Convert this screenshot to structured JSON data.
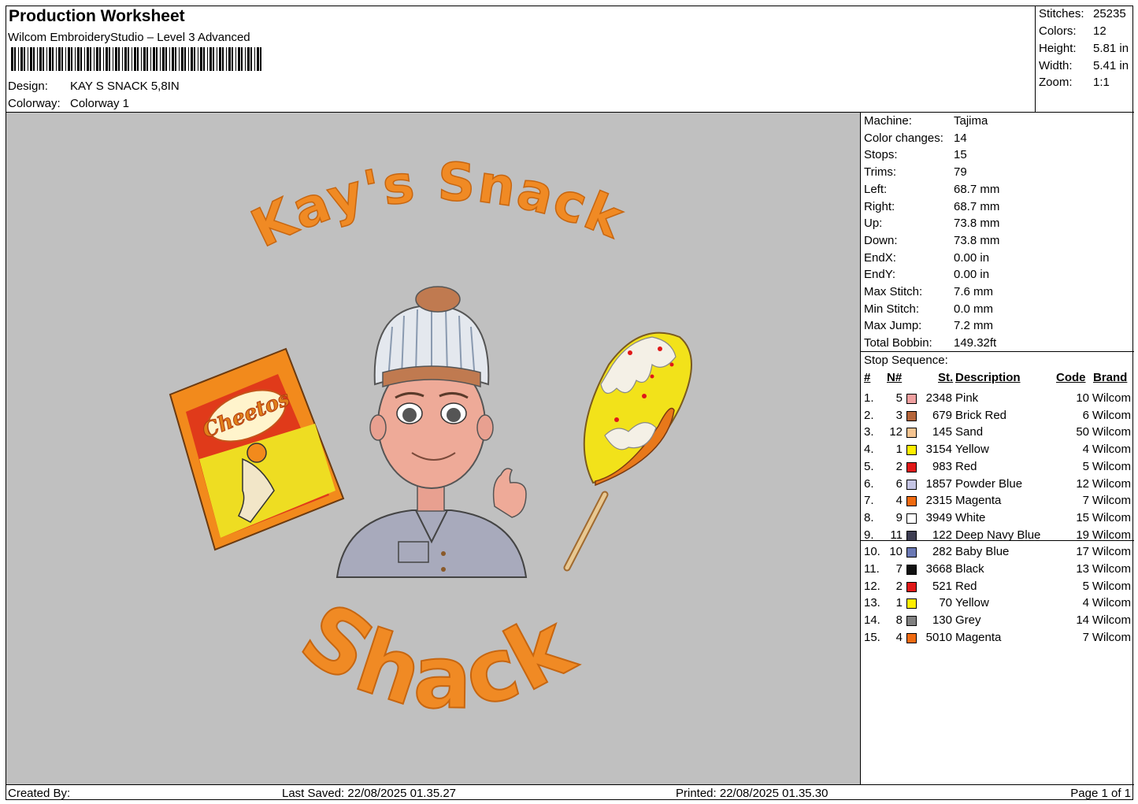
{
  "header": {
    "title": "Production Worksheet",
    "software": "Wilcom EmbroideryStudio – Level 3 Advanced",
    "design_label": "Design:",
    "design_value": "KAY S SNACK 5,8IN",
    "colorway_label": "Colorway:",
    "colorway_value": "Colorway 1"
  },
  "summary": {
    "stitches_label": "Stitches:",
    "stitches_value": "25235",
    "colors_label": "Colors:",
    "colors_value": "12",
    "height_label": "Height:",
    "height_value": "5.81 in",
    "width_label": "Width:",
    "width_value": "5.41 in",
    "zoom_label": "Zoom:",
    "zoom_value": "1:1"
  },
  "design_art": {
    "top_text": "Kay's Snack",
    "bottom_text": "Shack",
    "bag_text": "Cheetos",
    "thread_orange": "#f08a24",
    "background": "#c0c0c0"
  },
  "machine": {
    "rows": [
      {
        "label": "Machine:",
        "value": "Tajima"
      },
      {
        "label": "Color changes:",
        "value": "14"
      },
      {
        "label": "Stops:",
        "value": "15"
      },
      {
        "label": "Trims:",
        "value": "79"
      },
      {
        "label": "Left:",
        "value": "68.7 mm"
      },
      {
        "label": "Right:",
        "value": "68.7 mm"
      },
      {
        "label": "Up:",
        "value": "73.8 mm"
      },
      {
        "label": "Down:",
        "value": "73.8 mm"
      },
      {
        "label": "EndX:",
        "value": "0.00 in"
      },
      {
        "label": "EndY:",
        "value": "0.00 in"
      },
      {
        "label": "Max Stitch:",
        "value": "7.6 mm"
      },
      {
        "label": "Min Stitch:",
        "value": "0.0 mm"
      },
      {
        "label": "Max Jump:",
        "value": "7.2 mm"
      },
      {
        "label": "Total Bobbin:",
        "value": "149.32ft"
      }
    ]
  },
  "stop_sequence": {
    "title": "Stop Sequence:",
    "columns": {
      "idx": "#",
      "n": "N#",
      "st": "St.",
      "desc": "Description",
      "code": "Code",
      "brand": "Brand"
    },
    "rows": [
      {
        "idx": "1.",
        "n": "5",
        "color": "#f0a0a0",
        "st": "2348",
        "desc": "Pink",
        "code": "10",
        "brand": "Wilcom"
      },
      {
        "idx": "2.",
        "n": "3",
        "color": "#b5653a",
        "st": "679",
        "desc": "Brick Red",
        "code": "6",
        "brand": "Wilcom"
      },
      {
        "idx": "3.",
        "n": "12",
        "color": "#f5c491",
        "st": "145",
        "desc": "Sand",
        "code": "50",
        "brand": "Wilcom"
      },
      {
        "idx": "4.",
        "n": "1",
        "color": "#ffee00",
        "st": "3154",
        "desc": "Yellow",
        "code": "4",
        "brand": "Wilcom"
      },
      {
        "idx": "5.",
        "n": "2",
        "color": "#e01818",
        "st": "983",
        "desc": "Red",
        "code": "5",
        "brand": "Wilcom"
      },
      {
        "idx": "6.",
        "n": "6",
        "color": "#c4c4e4",
        "st": "1857",
        "desc": "Powder Blue",
        "code": "12",
        "brand": "Wilcom"
      },
      {
        "idx": "7.",
        "n": "4",
        "color": "#f06a10",
        "st": "2315",
        "desc": "Magenta",
        "code": "7",
        "brand": "Wilcom"
      },
      {
        "idx": "8.",
        "n": "9",
        "color": "#ffffff",
        "st": "3949",
        "desc": "White",
        "code": "15",
        "brand": "Wilcom"
      },
      {
        "idx": "9.",
        "n": "11",
        "color": "#3e3e52",
        "st": "122",
        "desc": "Deep Navy Blue",
        "code": "19",
        "brand": "Wilcom"
      },
      {
        "idx": "10.",
        "n": "10",
        "color": "#6a78b4",
        "st": "282",
        "desc": "Baby Blue",
        "code": "17",
        "brand": "Wilcom"
      },
      {
        "idx": "11.",
        "n": "7",
        "color": "#111111",
        "st": "3668",
        "desc": "Black",
        "code": "13",
        "brand": "Wilcom"
      },
      {
        "idx": "12.",
        "n": "2",
        "color": "#e01818",
        "st": "521",
        "desc": "Red",
        "code": "5",
        "brand": "Wilcom"
      },
      {
        "idx": "13.",
        "n": "1",
        "color": "#ffee00",
        "st": "70",
        "desc": "Yellow",
        "code": "4",
        "brand": "Wilcom"
      },
      {
        "idx": "14.",
        "n": "8",
        "color": "#808080",
        "st": "130",
        "desc": "Grey",
        "code": "14",
        "brand": "Wilcom"
      },
      {
        "idx": "15.",
        "n": "4",
        "color": "#f06a10",
        "st": "5010",
        "desc": "Magenta",
        "code": "7",
        "brand": "Wilcom"
      }
    ]
  },
  "footer": {
    "created_by": "Created By:",
    "last_saved": "Last Saved: 22/08/2025 01.35.27",
    "printed": "Printed: 22/08/2025 01.35.30",
    "page": "Page 1 of 1"
  }
}
